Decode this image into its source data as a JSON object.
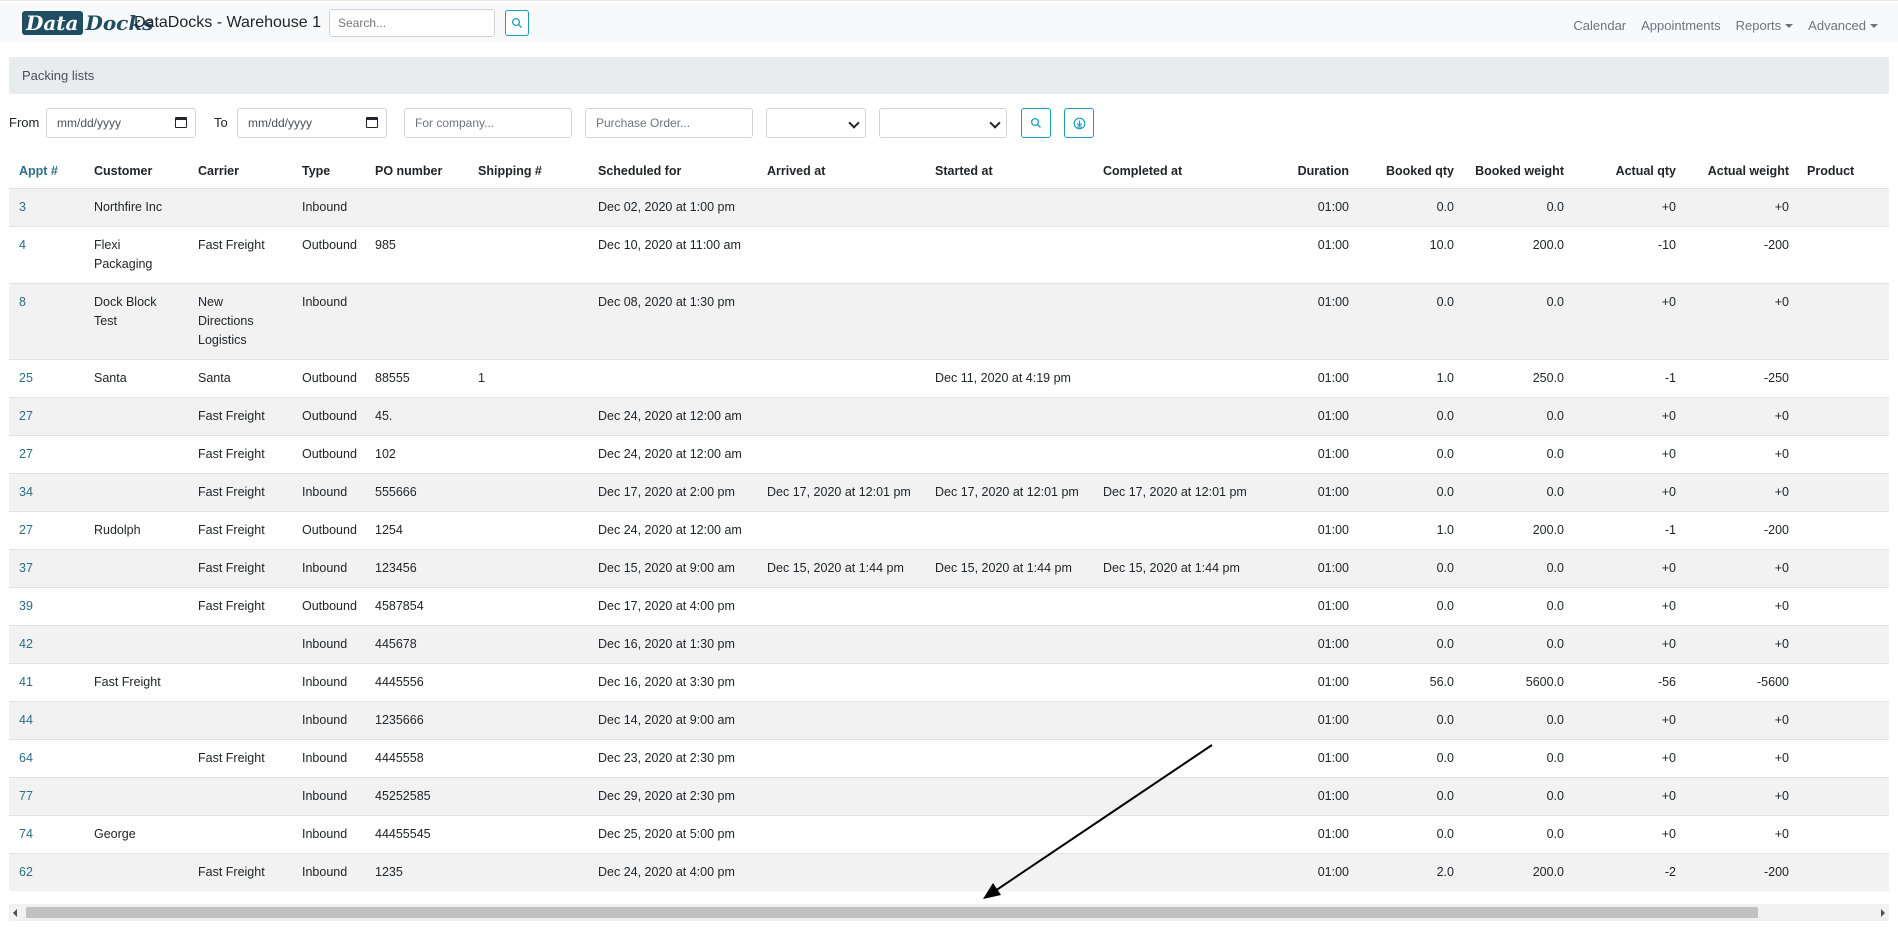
{
  "navbar": {
    "logo_part1": "Data",
    "logo_part2": "Docks",
    "brand": "DataDocks - Warehouse 1",
    "search_placeholder": "Search...",
    "menu": [
      "Calendar",
      "Appointments",
      "Reports",
      "Advanced"
    ]
  },
  "section_title": "Packing lists",
  "filters": {
    "from_label": "From",
    "to_label": "To",
    "date_placeholder": "mm/dd/yyyy",
    "company_placeholder": "For company...",
    "po_placeholder": "Purchase Order...",
    "select1_value": "",
    "select2_value": ""
  },
  "table": {
    "headers": [
      "Appt #",
      "Customer",
      "Carrier",
      "Type",
      "PO number",
      "Shipping #",
      "Scheduled for",
      "Arrived at",
      "Started at",
      "Completed at",
      "Duration",
      "Booked qty",
      "Booked weight",
      "Actual qty",
      "Actual weight",
      "Product"
    ],
    "rows": [
      {
        "appt": "3",
        "customer": [
          "Northfire Inc"
        ],
        "carrier": [],
        "type": "Inbound",
        "po": "",
        "shipping": "",
        "scheduled": "Dec 02, 2020 at 1:00 pm",
        "arrived": "",
        "started": "",
        "completed": "",
        "duration": "01:00",
        "booked_qty": "0.0",
        "booked_weight": "0.0",
        "actual_qty": "+0",
        "actual_weight": "+0",
        "product": ""
      },
      {
        "appt": "4",
        "customer": [
          "Flexi",
          "Packaging"
        ],
        "carrier": [
          "Fast Freight"
        ],
        "type": "Outbound",
        "po": "985",
        "shipping": "",
        "scheduled": "Dec 10, 2020 at 11:00 am",
        "arrived": "",
        "started": "",
        "completed": "",
        "duration": "01:00",
        "booked_qty": "10.0",
        "booked_weight": "200.0",
        "actual_qty": "-10",
        "actual_weight": "-200",
        "product": ""
      },
      {
        "appt": "8",
        "customer": [
          "Dock Block",
          "Test"
        ],
        "carrier": [
          "New",
          "Directions",
          "Logistics"
        ],
        "type": "Inbound",
        "po": "",
        "shipping": "",
        "scheduled": "Dec 08, 2020 at 1:30 pm",
        "arrived": "",
        "started": "",
        "completed": "",
        "duration": "01:00",
        "booked_qty": "0.0",
        "booked_weight": "0.0",
        "actual_qty": "+0",
        "actual_weight": "+0",
        "product": ""
      },
      {
        "appt": "25",
        "customer": [
          "Santa"
        ],
        "carrier": [
          "Santa"
        ],
        "type": "Outbound",
        "po": "88555",
        "shipping": "1",
        "scheduled": "",
        "arrived": "",
        "started": "Dec 11, 2020 at 4:19 pm",
        "completed": "",
        "duration": "01:00",
        "booked_qty": "1.0",
        "booked_weight": "250.0",
        "actual_qty": "-1",
        "actual_weight": "-250",
        "product": ""
      },
      {
        "appt": "27",
        "customer": [],
        "carrier": [
          "Fast Freight"
        ],
        "type": "Outbound",
        "po": "45.",
        "shipping": "",
        "scheduled": "Dec 24, 2020 at 12:00 am",
        "arrived": "",
        "started": "",
        "completed": "",
        "duration": "01:00",
        "booked_qty": "0.0",
        "booked_weight": "0.0",
        "actual_qty": "+0",
        "actual_weight": "+0",
        "product": ""
      },
      {
        "appt": "27",
        "customer": [],
        "carrier": [
          "Fast Freight"
        ],
        "type": "Outbound",
        "po": "102",
        "shipping": "",
        "scheduled": "Dec 24, 2020 at 12:00 am",
        "arrived": "",
        "started": "",
        "completed": "",
        "duration": "01:00",
        "booked_qty": "0.0",
        "booked_weight": "0.0",
        "actual_qty": "+0",
        "actual_weight": "+0",
        "product": ""
      },
      {
        "appt": "34",
        "customer": [],
        "carrier": [
          "Fast Freight"
        ],
        "type": "Inbound",
        "po": "555666",
        "shipping": "",
        "scheduled": "Dec 17, 2020 at 2:00 pm",
        "arrived": "Dec 17, 2020 at 12:01 pm",
        "started": "Dec 17, 2020 at 12:01 pm",
        "completed": "Dec 17, 2020 at 12:01 pm",
        "duration": "01:00",
        "booked_qty": "0.0",
        "booked_weight": "0.0",
        "actual_qty": "+0",
        "actual_weight": "+0",
        "product": ""
      },
      {
        "appt": "27",
        "customer": [
          "Rudolph"
        ],
        "carrier": [
          "Fast Freight"
        ],
        "type": "Outbound",
        "po": "1254",
        "shipping": "",
        "scheduled": "Dec 24, 2020 at 12:00 am",
        "arrived": "",
        "started": "",
        "completed": "",
        "duration": "01:00",
        "booked_qty": "1.0",
        "booked_weight": "200.0",
        "actual_qty": "-1",
        "actual_weight": "-200",
        "product": ""
      },
      {
        "appt": "37",
        "customer": [],
        "carrier": [
          "Fast Freight"
        ],
        "type": "Inbound",
        "po": "123456",
        "shipping": "",
        "scheduled": "Dec 15, 2020 at 9:00 am",
        "arrived": "Dec 15, 2020 at 1:44 pm",
        "started": "Dec 15, 2020 at 1:44 pm",
        "completed": "Dec 15, 2020 at 1:44 pm",
        "duration": "01:00",
        "booked_qty": "0.0",
        "booked_weight": "0.0",
        "actual_qty": "+0",
        "actual_weight": "+0",
        "product": ""
      },
      {
        "appt": "39",
        "customer": [],
        "carrier": [
          "Fast Freight"
        ],
        "type": "Outbound",
        "po": "4587854",
        "shipping": "",
        "scheduled": "Dec 17, 2020 at 4:00 pm",
        "arrived": "",
        "started": "",
        "completed": "",
        "duration": "01:00",
        "booked_qty": "0.0",
        "booked_weight": "0.0",
        "actual_qty": "+0",
        "actual_weight": "+0",
        "product": ""
      },
      {
        "appt": "42",
        "customer": [],
        "carrier": [],
        "type": "Inbound",
        "po": "445678",
        "shipping": "",
        "scheduled": "Dec 16, 2020 at 1:30 pm",
        "arrived": "",
        "started": "",
        "completed": "",
        "duration": "01:00",
        "booked_qty": "0.0",
        "booked_weight": "0.0",
        "actual_qty": "+0",
        "actual_weight": "+0",
        "product": ""
      },
      {
        "appt": "41",
        "customer": [
          "Fast Freight"
        ],
        "carrier": [],
        "type": "Inbound",
        "po": "4445556",
        "shipping": "",
        "scheduled": "Dec 16, 2020 at 3:30 pm",
        "arrived": "",
        "started": "",
        "completed": "",
        "duration": "01:00",
        "booked_qty": "56.0",
        "booked_weight": "5600.0",
        "actual_qty": "-56",
        "actual_weight": "-5600",
        "product": ""
      },
      {
        "appt": "44",
        "customer": [],
        "carrier": [],
        "type": "Inbound",
        "po": "1235666",
        "shipping": "",
        "scheduled": "Dec 14, 2020 at 9:00 am",
        "arrived": "",
        "started": "",
        "completed": "",
        "duration": "01:00",
        "booked_qty": "0.0",
        "booked_weight": "0.0",
        "actual_qty": "+0",
        "actual_weight": "+0",
        "product": ""
      },
      {
        "appt": "64",
        "customer": [],
        "carrier": [
          "Fast Freight"
        ],
        "type": "Inbound",
        "po": "4445558",
        "shipping": "",
        "scheduled": "Dec 23, 2020 at 2:30 pm",
        "arrived": "",
        "started": "",
        "completed": "",
        "duration": "01:00",
        "booked_qty": "0.0",
        "booked_weight": "0.0",
        "actual_qty": "+0",
        "actual_weight": "+0",
        "product": ""
      },
      {
        "appt": "77",
        "customer": [],
        "carrier": [],
        "type": "Inbound",
        "po": "45252585",
        "shipping": "",
        "scheduled": "Dec 29, 2020 at 2:30 pm",
        "arrived": "",
        "started": "",
        "completed": "",
        "duration": "01:00",
        "booked_qty": "0.0",
        "booked_weight": "0.0",
        "actual_qty": "+0",
        "actual_weight": "+0",
        "product": ""
      },
      {
        "appt": "74",
        "customer": [
          "George"
        ],
        "carrier": [],
        "type": "Inbound",
        "po": "44455545",
        "shipping": "",
        "scheduled": "Dec 25, 2020 at 5:00 pm",
        "arrived": "",
        "started": "",
        "completed": "",
        "duration": "01:00",
        "booked_qty": "0.0",
        "booked_weight": "0.0",
        "actual_qty": "+0",
        "actual_weight": "+0",
        "product": ""
      },
      {
        "appt": "62",
        "customer": [],
        "carrier": [
          "Fast Freight"
        ],
        "type": "Inbound",
        "po": "1235",
        "shipping": "",
        "scheduled": "Dec 24, 2020 at 4:00 pm",
        "arrived": "",
        "started": "",
        "completed": "",
        "duration": "01:00",
        "booked_qty": "2.0",
        "booked_weight": "200.0",
        "actual_qty": "-2",
        "actual_weight": "-200",
        "product": ""
      }
    ]
  },
  "colors": {
    "link": "#2a6e8a",
    "accent_button_border": "#17a2b8",
    "logo_bg": "#1f4e63",
    "stripe": "#f2f2f2"
  },
  "icons": {
    "search_button": "search-icon",
    "export_button": "download-icon",
    "annotation": "arrow-pointing-to-scrollbar"
  }
}
